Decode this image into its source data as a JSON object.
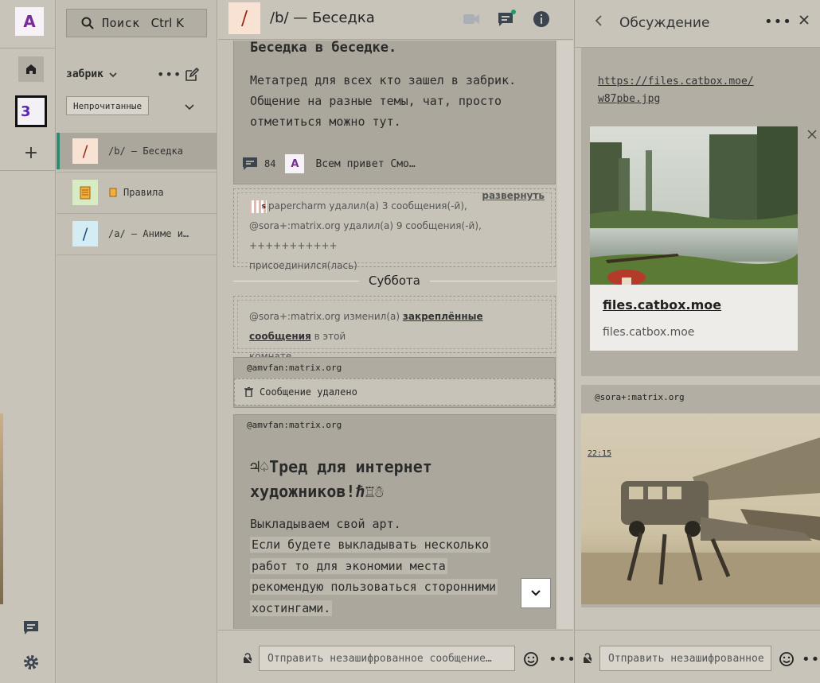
{
  "rail": {
    "account_initial": "A",
    "space_badge": "3",
    "add_label": "+"
  },
  "search": {
    "label": "Поиск",
    "shortcut": "Ctrl K"
  },
  "space": {
    "name": "забрик",
    "more": "•••"
  },
  "filter": {
    "label": "Непрочитанные"
  },
  "rooms": [
    {
      "avatar": "/",
      "name": "/b/ — Беседка",
      "avatar_bg": "#f8e2d4",
      "avatar_color": "#9a2a14"
    },
    {
      "avatar": "",
      "name": "Правила",
      "avatar_bg": "#d8ecc4",
      "avatar_color": "#c07a20"
    },
    {
      "avatar": "/",
      "name": "/a/ — Аниме и…",
      "avatar_bg": "#d4ecf4",
      "avatar_color": "#1a4a7a"
    }
  ],
  "header": {
    "avatar": "/",
    "title": "/b/ — Беседка"
  },
  "pinned": {
    "title": "Беседка в беседке.",
    "body": "Метатред для всех кто зашел в забрик. Общение на разные темы, чат, просто отметиться можно тут.",
    "thread_count": "84",
    "last_author_initial": "A",
    "last_preview": "Всем привет Смо…"
  },
  "collapsed_events": {
    "expand_label": "развернуть",
    "avatar_letter": "s",
    "line1": "papercharm удалил(а) 3 сообщения(-й),",
    "line2": "@sora+:matrix.org удалил(а) 9 сообщения(-й), +++++++++++",
    "line3": "присоединился(лась)"
  },
  "date_separator": "Суббота",
  "pin_event": {
    "prefix": "@sora+:matrix.org изменил(а) ",
    "link": "закреплённые сообщения",
    "suffix": " в этой",
    "line2": "комнате."
  },
  "deleted_msg": {
    "sender": "@amvfan:matrix.org",
    "text": "Сообщение удалено"
  },
  "art_thread": {
    "sender": "@amvfan:matrix.org",
    "title_line1": "♃♤Тред для интернет",
    "title_line2": "художников!ℏ♖☃",
    "line1": "Выкладываем свой арт.",
    "quote1": "Если будете выкладывать несколько",
    "quote2": "работ то для экономии места",
    "quote3": "рекомендую пользоваться сторонними",
    "quote4": "хостингами."
  },
  "composer": {
    "placeholder": "Отправить незашифрованное сообщение…"
  },
  "thread_panel": {
    "title": "Обсуждение",
    "link_line1": "https://files.catbox.moe/",
    "link_line2": "w87pbe.jpg",
    "preview_title": "files.catbox.moe",
    "preview_site": "files.catbox.moe",
    "sender2": "@sora+:matrix.org",
    "time2": "22:15",
    "composer_placeholder": "Отправить незашифрованное сообщение…"
  },
  "colors": {
    "accent": "#2e8a72",
    "notification_dot": "#1f9a6e"
  }
}
